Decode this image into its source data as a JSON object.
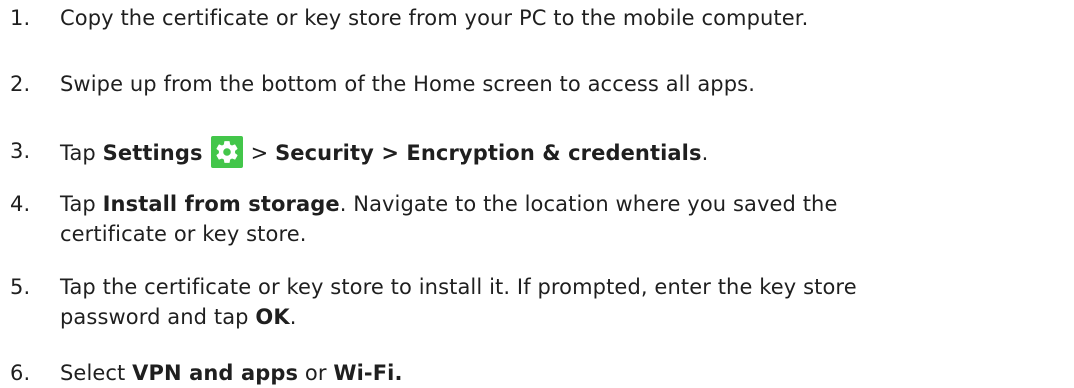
{
  "steps": [
    {
      "number": "1.",
      "lines": [
        [
          {
            "text": "Copy the certificate or key store from your PC to the mobile computer.",
            "bold": false
          }
        ]
      ]
    },
    {
      "number": "2.",
      "lines": [
        [
          {
            "text": "Swipe up from the bottom of the Home screen to access all apps.",
            "bold": false
          }
        ]
      ]
    },
    {
      "number": "3.",
      "lines": [
        [
          {
            "text": "Tap ",
            "bold": false
          },
          {
            "text": "Settings",
            "bold": true
          },
          {
            "icon": "settings-gear-icon"
          },
          {
            "text": "> ",
            "bold": false
          },
          {
            "text": "Security > Encryption & credentials",
            "bold": true
          },
          {
            "text": ".",
            "bold": false
          }
        ]
      ]
    },
    {
      "number": "4.",
      "lines": [
        [
          {
            "text": "Tap ",
            "bold": false
          },
          {
            "text": "Install from storage",
            "bold": true
          },
          {
            "text": ". Navigate to the location where you saved the",
            "bold": false
          }
        ],
        [
          {
            "text": "certificate or key store.",
            "bold": false
          }
        ]
      ]
    },
    {
      "number": "5.",
      "lines": [
        [
          {
            "text": "Tap the certificate or key store to install it. If prompted, enter the key store",
            "bold": false
          }
        ],
        [
          {
            "text": "password and tap ",
            "bold": false
          },
          {
            "text": "OK",
            "bold": true
          },
          {
            "text": ".",
            "bold": false
          }
        ]
      ]
    },
    {
      "number": "6.",
      "lines": [
        [
          {
            "text": "Select ",
            "bold": false
          },
          {
            "text": "VPN and apps",
            "bold": true
          },
          {
            "text": " or ",
            "bold": false
          },
          {
            "text": "Wi-Fi.",
            "bold": true
          }
        ]
      ]
    }
  ],
  "colors": {
    "text": "#1f1f1f",
    "settings_icon_bg": "#43c64a",
    "settings_icon_fg": "#ffffff"
  }
}
